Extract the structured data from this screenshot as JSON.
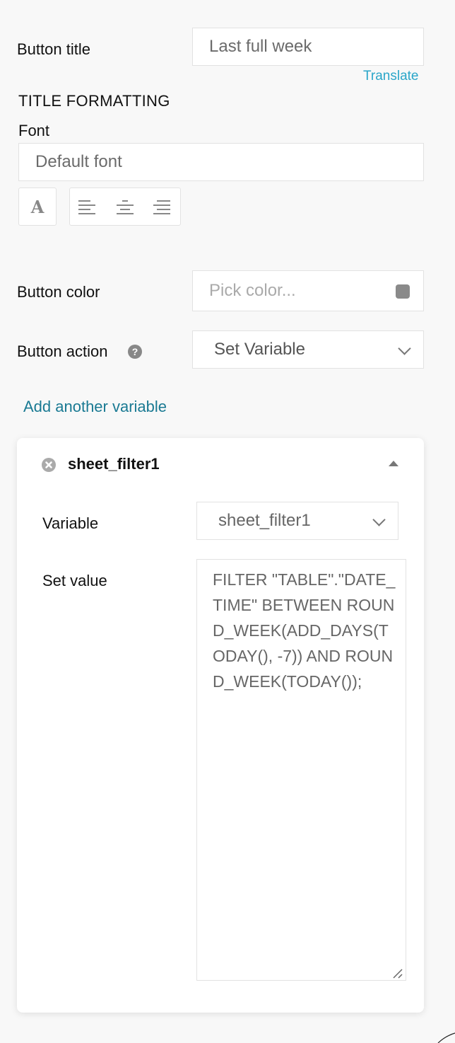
{
  "button_title": {
    "label": "Button title",
    "value": "Last full week",
    "translate_link": "Translate"
  },
  "title_formatting": {
    "heading": "TITLE FORMATTING",
    "font_label": "Font",
    "font_value": "Default font",
    "font_style_icon": "A",
    "alignment_icons": [
      "align-left-icon",
      "align-center-icon",
      "align-right-icon"
    ]
  },
  "button_color": {
    "label": "Button color",
    "placeholder": "Pick color...",
    "swatch_color": "#8a8a8a"
  },
  "button_action": {
    "label": "Button action",
    "help_icon": "?",
    "value": "Set Variable"
  },
  "add_variable_link": "Add another variable",
  "variable_card": {
    "title": "sheet_filter1",
    "variable_label": "Variable",
    "variable_value": "sheet_filter1",
    "set_value_label": "Set value",
    "set_value": "FILTER \"TABLE\".\"DATE_TIME\" BETWEEN ROUND_WEEK(ADD_DAYS(TODAY(), -7)) AND ROUND_WEEK(TODAY());"
  },
  "colors": {
    "link": "#1a7a93",
    "translate": "#2aa6c9",
    "background": "#f8f8f8"
  }
}
